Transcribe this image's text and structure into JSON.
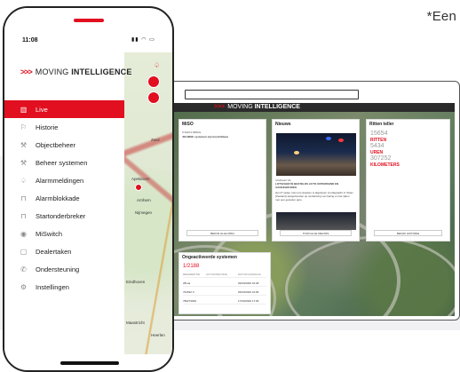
{
  "corner_text": "*Een",
  "phone": {
    "time": "11:08",
    "status_icons": "▮▮ ◠ ▭",
    "logo_prefix": ">>>",
    "logo_text_light": "MOVING",
    "logo_text_bold": "INTELLIGENCE",
    "menu": [
      {
        "label": "Live",
        "icon": "map-icon",
        "active": true
      },
      {
        "label": "Historie",
        "icon": "flag-icon",
        "active": false
      },
      {
        "label": "Objectbeheer",
        "icon": "wrench-icon",
        "active": false
      },
      {
        "label": "Beheer systemen",
        "icon": "wrench-icon",
        "active": false
      },
      {
        "label": "Alarmmeldingen",
        "icon": "bell-icon",
        "active": false
      },
      {
        "label": "Alarmblokkade",
        "icon": "lock-icon",
        "active": false
      },
      {
        "label": "Startonderbreker",
        "icon": "lock-icon",
        "active": false
      },
      {
        "label": "MiSwitch",
        "icon": "signal-icon",
        "active": false
      },
      {
        "label": "Dealertaken",
        "icon": "clipboard-icon",
        "active": false
      },
      {
        "label": "Ondersteuning",
        "icon": "phone-icon",
        "active": false
      },
      {
        "label": "Instellingen",
        "icon": "gear-icon",
        "active": false
      }
    ],
    "map_labels": [
      "Zwol",
      "Apeldoorn",
      "Arnhem",
      "Nijmegen",
      "Maastricht",
      "Heerlen",
      "Eindhoven"
    ]
  },
  "laptop": {
    "logo_prefix": ">>>",
    "logo_light": "MOVING",
    "logo_bold": "INTELLIGENCE",
    "miso": {
      "title": "MiSO",
      "line1": "0 SoM 2 MISOs",
      "line2": "403.MISE systemen zijn beschikbaar",
      "button": "BEKIJK ALLE MiSO"
    },
    "news": {
      "title": "Nieuws",
      "date": "4 februari '21",
      "headline": "LOTSCHER IN BESTELDS AUTO ONTERKEND EN AANGEHOUDEN",
      "body": "Het 27 jarige man uit Lissewen is afgelopen zondagnacht in Sloan (Zeeland) aangehouden op verdenking van heling en het rijden met een gestolen auto.",
      "button": "TOON ALLE NIEUWS"
    },
    "teller": {
      "title": "Ritten teller",
      "rows": [
        {
          "value": "15654",
          "label": "RITTEN"
        },
        {
          "value": "5434",
          "label": "UREN"
        },
        {
          "value": "307252",
          "label": "KILOMETERS"
        }
      ],
      "button": "BEKIJK HISTORIE"
    },
    "inactive": {
      "title": "Ongeactiveerde systemen",
      "count": "1/2188",
      "columns": [
        "REFERENTIE",
        "ACTIVATIECODE",
        "DATUM AANMAAK"
      ],
      "rows": [
        [
          "28mia",
          "",
          "03/03/2020 10:28"
        ],
        [
          "761520 0",
          "",
          "26/03/2020 16:06"
        ],
        [
          "786274929",
          "",
          "17/03/2020 17:06"
        ]
      ]
    }
  }
}
